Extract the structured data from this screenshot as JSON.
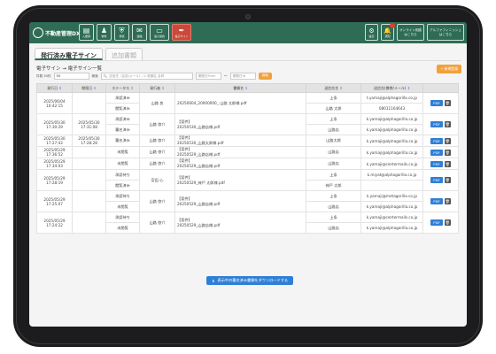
{
  "header": {
    "brand": "不動産管理DX",
    "nav": [
      {
        "icon": "▤",
        "label": "入居者",
        "name": "nav-tenant"
      },
      {
        "icon": "♟",
        "label": "物件",
        "name": "nav-property"
      },
      {
        "icon": "⛨",
        "label": "修繕",
        "name": "nav-repair"
      },
      {
        "icon": "✉",
        "label": "連絡",
        "name": "nav-contact"
      },
      {
        "icon": "▭",
        "label": "電子契約",
        "name": "nav-contract"
      },
      {
        "icon": "✒",
        "label": "電子サイン",
        "name": "nav-esign"
      }
    ],
    "right_icons": [
      {
        "icon": "⚙",
        "label": "設定",
        "name": "settings"
      },
      {
        "icon": "🔔",
        "label": "通知",
        "name": "notifications"
      }
    ],
    "buttons": [
      {
        "l1": "オンライン相談",
        "l2": "はこちら"
      },
      {
        "l1": "アルファフィニッシュ",
        "l2": "はこちら"
      }
    ]
  },
  "tabs": [
    "発行済み電子サイン",
    "追加書類"
  ],
  "page_title": "電子サイン → 電子サイン一覧",
  "new_button": "+ 新規登録",
  "filters": {
    "count_label": "件数  50件",
    "count_value": "50",
    "search_label": "検索",
    "search_placeholder": "送信先（名前/メール）/ 2 書類名 名称",
    "date_from": "期間日From",
    "date_sep": "〜",
    "date_to": "期間日To",
    "search_button": "検索"
  },
  "table": {
    "headers": [
      "発行日",
      "期限日",
      "ステータス",
      "発行者",
      "書類名",
      "送信先名",
      "送信先(携帯/メール)",
      ""
    ],
    "rows": [
      {
        "issued": "2025/06/04\n10:42:15",
        "deadline": "",
        "issuer": "山路 良",
        "doc_tag": "",
        "doc": "20250604_20000000_ 山路 太郎様.pdf",
        "subs": [
          {
            "status": "承認済み",
            "to": "上条",
            "contact": "t.yamaji@alphagorilla.co.jp"
          },
          {
            "status": "閲覧済み",
            "to": "山路 太郎",
            "contact": "08011164643"
          }
        ]
      },
      {
        "issued": "2025/05/30\n17:30:29",
        "deadline": "2025/05/30\n17:31:08",
        "issuer": "山路 啓介",
        "doc_tag": "【案件】",
        "doc": "20250530_山路店様.pdf",
        "subs": [
          {
            "status": "承認済み",
            "to": "上条",
            "contact": "k.yamaji@alphagorilla.co.jp"
          },
          {
            "status": "署名済み",
            "to": "山路店",
            "contact": "k.yamaji@alphagorilla.co.jp"
          }
        ]
      },
      {
        "issued": "2025/05/30\n17:27:42",
        "deadline": "2025/05/30\n17:28:28",
        "issuer": "山路 啓介",
        "doc_tag": "【案件】",
        "doc": "20250530_山路太郎様.pdf",
        "subs": [
          {
            "status": "署名済み",
            "to": "山路太郎",
            "contact": "k.yamaji@alphagorilla.co.jp"
          }
        ]
      },
      {
        "issued": "2025/05/29\n17:36:52",
        "deadline": "",
        "issuer": "山路 啓介",
        "doc_tag": "【案件】",
        "doc": "20250529_山路店様.pdf",
        "subs": [
          {
            "status": "未閲覧",
            "to": "山路店",
            "contact": "k.yamaji@alphagorilla.co.jp"
          }
        ]
      },
      {
        "issued": "2025/05/29\n17:34:03",
        "deadline": "",
        "issuer": "山路 啓介",
        "doc_tag": "【案件】",
        "doc": "20250529_山路店様.pdf",
        "subs": [
          {
            "status": "未閲覧",
            "to": "山路店",
            "contact": "k.yamaji@centermails.co.jp"
          }
        ]
      },
      {
        "issued": "2025/05/29\n17:28:19",
        "deadline": "",
        "issuer": "宮田 心",
        "doc_tag": "【案件】",
        "doc": "20250529_神戸 太郎様.pdf",
        "subs": [
          {
            "status": "承認待ち",
            "to": "上条",
            "contact": "k.miyat@alphagorilla.co.jp"
          },
          {
            "status": "閲覧済み",
            "to": "神戸 太郎",
            "contact": ""
          }
        ]
      },
      {
        "issued": "2025/05/29\n17:25:07",
        "deadline": "",
        "issuer": "山路 啓介",
        "doc_tag": "【案件】",
        "doc": "20250529_山路店様.pdf",
        "subs": [
          {
            "status": "承認待ち",
            "to": "上条",
            "contact": "k.yamaji@metagorilla.co.jp"
          },
          {
            "status": "未閲覧",
            "to": "山路店",
            "contact": "k.yamaji@alphagorilla.co.jp"
          }
        ]
      },
      {
        "issued": "2025/05/29\n17:24:22",
        "deadline": "",
        "issuer": "山路 啓介",
        "doc_tag": "【案件】",
        "doc": "20250529_山路店様.pdf",
        "subs": [
          {
            "status": "承認待ち",
            "to": "上条",
            "contact": "k.yamaji@centermails.co.jp"
          },
          {
            "status": "未閲覧",
            "to": "山路店",
            "contact": "k.yamaji@alphagorilla.co.jp"
          }
        ]
      }
    ],
    "pdf_label": "PDF",
    "delete_label": "🗑"
  },
  "download_button": "表示中の署名済み書類をダウンロードする"
}
